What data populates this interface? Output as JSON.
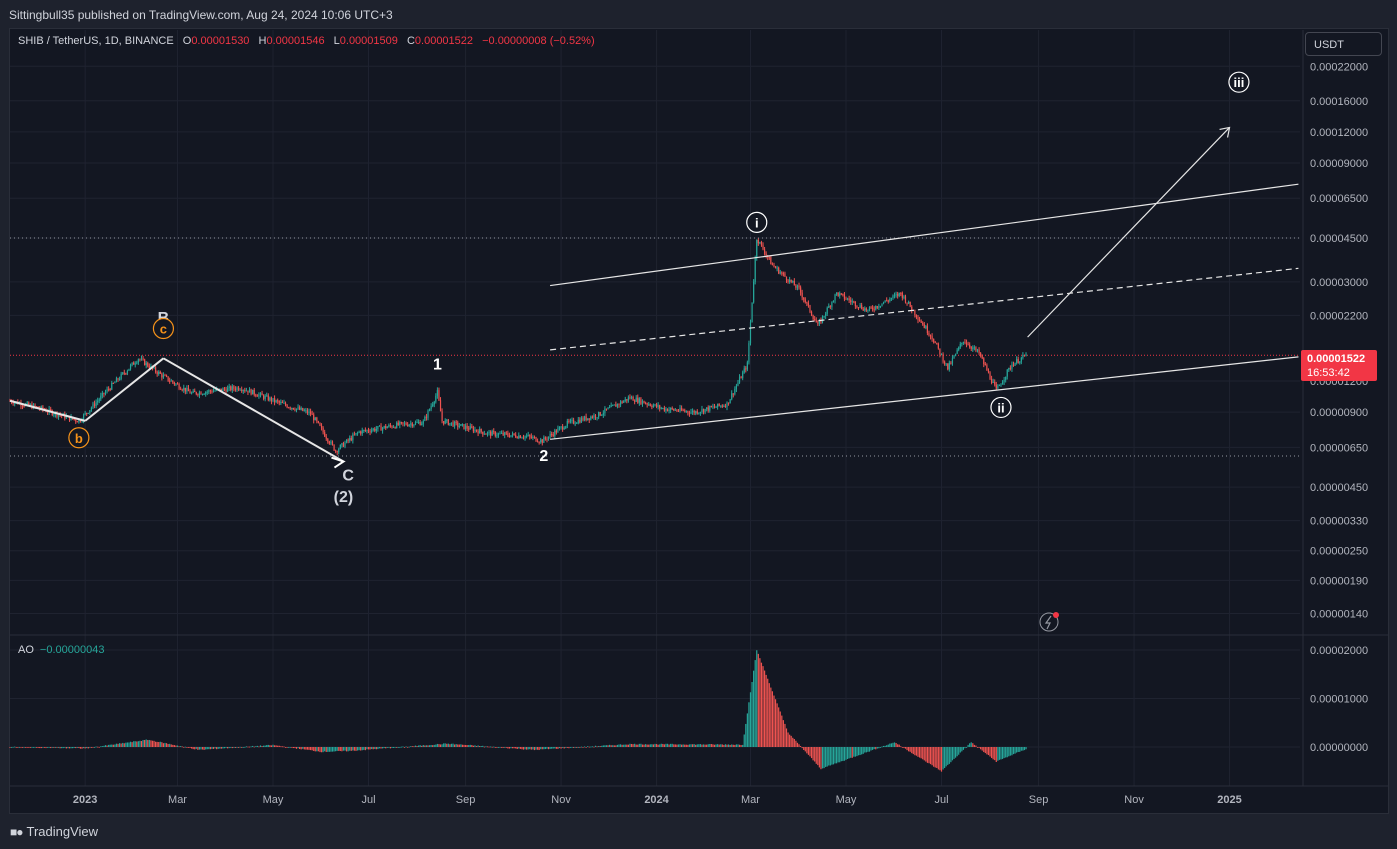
{
  "header": {
    "publisher": "Sittingbull35 published on TradingView.com, Aug 24, 2024 10:06 UTC+3"
  },
  "legend": {
    "symbol": "SHIB / TetherUS, 1D, BINANCE",
    "open_label": "O",
    "open": "0.00001530",
    "high_label": "H",
    "high": "0.00001546",
    "low_label": "L",
    "low": "0.00001509",
    "close_label": "C",
    "close": "0.00001522",
    "change": "−0.00000008 (−0.52%)"
  },
  "currency_button": "USDT",
  "price_badge": {
    "price": "0.00001522",
    "countdown": "16:53:42"
  },
  "indicator": {
    "name": "AO",
    "value": "−0.00000043"
  },
  "footer": {
    "brand": "TradingView"
  },
  "colors": {
    "up": "#26a69a",
    "down": "#ef5350",
    "background": "#131722",
    "wave_orange": "#f7931a",
    "price_line": "#f23645"
  },
  "chart_data": {
    "type": "candlestick",
    "price_axis": {
      "scale": "log",
      "ticks": [
        "0.00022000",
        "0.00016000",
        "0.00012000",
        "0.00009000",
        "0.00006500",
        "0.00004500",
        "0.00003000",
        "0.00002200",
        "0.00001200",
        "0.00000900",
        "0.00000650",
        "0.00000450",
        "0.00000330",
        "0.00000250",
        "0.00000190",
        "0.00000140"
      ]
    },
    "ao_axis": {
      "ticks": [
        "0.00002000",
        "0.00001000",
        "0.00000000"
      ]
    },
    "time_axis": {
      "ticks": [
        "2023",
        "Mar",
        "May",
        "Jul",
        "Sep",
        "Nov",
        "2024",
        "Mar",
        "May",
        "Jul",
        "Sep",
        "Nov",
        "2025"
      ]
    },
    "price_path": [
      [
        "2022-11-14",
        1e-05
      ],
      [
        "2022-12-01",
        9.4e-06
      ],
      [
        "2022-12-28",
        8.3e-06
      ],
      [
        "2023-01-15",
        1.1e-05
      ],
      [
        "2023-02-04",
        1.48e-05
      ],
      [
        "2023-02-20",
        1.25e-05
      ],
      [
        "2023-03-10",
        1.07e-05
      ],
      [
        "2023-04-10",
        1.13e-05
      ],
      [
        "2023-05-05",
        9.8e-06
      ],
      [
        "2023-05-25",
        8.9e-06
      ],
      [
        "2023-06-10",
        6.3e-06
      ],
      [
        "2023-06-25",
        7.5e-06
      ],
      [
        "2023-07-20",
        8e-06
      ],
      [
        "2023-08-05",
        8.2e-06
      ],
      [
        "2023-08-14",
        1.08e-05
      ],
      [
        "2023-08-17",
        8.3e-06
      ],
      [
        "2023-09-15",
        7.4e-06
      ],
      [
        "2023-10-10",
        7.2e-06
      ],
      [
        "2023-10-20",
        6.9e-06
      ],
      [
        "2023-11-05",
        8.1e-06
      ],
      [
        "2023-11-25",
        8.8e-06
      ],
      [
        "2023-12-15",
        1.03e-05
      ],
      [
        "2024-01-05",
        9.3e-06
      ],
      [
        "2024-01-25",
        9e-06
      ],
      [
        "2024-02-15",
        9.7e-06
      ],
      [
        "2024-02-28",
        1.4e-05
      ],
      [
        "2024-03-05",
        4.5e-05
      ],
      [
        "2024-03-15",
        3.5e-05
      ],
      [
        "2024-04-01",
        2.8e-05
      ],
      [
        "2024-04-13",
        2e-05
      ],
      [
        "2024-04-25",
        2.7e-05
      ],
      [
        "2024-05-15",
        2.3e-05
      ],
      [
        "2024-06-05",
        2.7e-05
      ],
      [
        "2024-06-25",
        1.8e-05
      ],
      [
        "2024-07-05",
        1.35e-05
      ],
      [
        "2024-07-15",
        1.75e-05
      ],
      [
        "2024-07-25",
        1.55e-05
      ],
      [
        "2024-08-05",
        1.1e-05
      ],
      [
        "2024-08-15",
        1.4e-05
      ],
      [
        "2024-08-24",
        1.52e-05
      ]
    ],
    "last_close": 1.522e-05,
    "horizontal_levels": [
      4.5e-05,
      6e-06
    ],
    "ao_path": [
      [
        "2022-11-14",
        0
      ],
      [
        "2023-01-01",
        -3e-07
      ],
      [
        "2023-02-10",
        1.5e-06
      ],
      [
        "2023-03-15",
        -6e-07
      ],
      [
        "2023-05-01",
        4e-07
      ],
      [
        "2023-06-01",
        -1e-06
      ],
      [
        "2023-06-20",
        -8e-07
      ],
      [
        "2023-08-20",
        7e-07
      ],
      [
        "2023-10-15",
        -6e-07
      ],
      [
        "2023-12-15",
        6e-07
      ],
      [
        "2024-02-25",
        5e-07
      ],
      [
        "2024-03-05",
        2e-05
      ],
      [
        "2024-03-25",
        3e-06
      ],
      [
        "2024-04-15",
        -4.5e-06
      ],
      [
        "2024-06-01",
        1e-06
      ],
      [
        "2024-07-01",
        -5e-06
      ],
      [
        "2024-07-20",
        1e-06
      ],
      [
        "2024-08-05",
        -3e-06
      ],
      [
        "2024-08-24",
        -4.3e-07
      ]
    ],
    "annotations": [
      {
        "text": "B",
        "color": "#d1d4dc"
      },
      {
        "text": "c",
        "color": "#f7931a",
        "circled": true
      },
      {
        "text": "b",
        "color": "#f7931a",
        "circled": true
      },
      {
        "text": "C",
        "color": "#d1d4dc"
      },
      {
        "text": "(2)",
        "color": "#d1d4dc"
      },
      {
        "text": "1",
        "color": "#ffffff"
      },
      {
        "text": "2",
        "color": "#ffffff"
      },
      {
        "text": "i",
        "color": "#ffffff",
        "circled": true
      },
      {
        "text": "ii",
        "color": "#ffffff",
        "circled": true
      },
      {
        "text": "iii",
        "color": "#ffffff",
        "circled": true
      }
    ]
  }
}
